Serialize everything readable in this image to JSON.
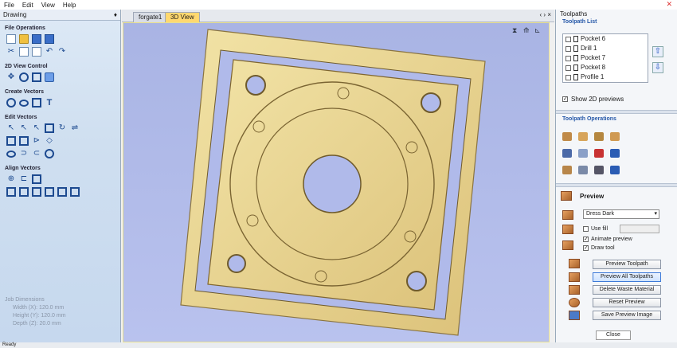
{
  "menu": [
    "File",
    "Edit",
    "View",
    "Help"
  ],
  "left_panel": {
    "title": "Drawing",
    "pin": "♦",
    "sections": {
      "file_ops": "File Operations",
      "view_ctrl": "2D View Control",
      "create_vectors": "Create Vectors",
      "edit_vectors": "Edit Vectors",
      "align_vectors": "Align Vectors"
    },
    "job": {
      "title": "Job Dimensions",
      "width": "Width  (X): 120.0 mm",
      "height": "Height (Y): 120.0 mm",
      "depth": "Depth  (Z): 20.0 mm"
    }
  },
  "tabs": [
    {
      "label": "forgate1",
      "active": false
    },
    {
      "label": "3D View",
      "active": true
    }
  ],
  "tab_controls": "‹ › ×",
  "right_panel": {
    "title": "Toolpaths",
    "pin": "♦",
    "list_title": "Toolpath List",
    "toolpaths": [
      {
        "name": "Pocket 6",
        "checked": false
      },
      {
        "name": "Drill 1",
        "checked": false
      },
      {
        "name": "Pocket 7",
        "checked": false
      },
      {
        "name": "Pocket 8",
        "checked": false
      },
      {
        "name": "Profile 1",
        "checked": false
      }
    ],
    "show_2d": "Show 2D previews",
    "ops_title": "Toolpath Operations",
    "preview_title": "Preview",
    "material": "Dress Dark",
    "use_fill": "Use fill",
    "animate": "Animate preview",
    "draw_tool": "Draw tool",
    "buttons": {
      "preview_toolpath": "Preview Toolpath",
      "preview_all": "Preview All Toolpaths",
      "delete_waste": "Delete Waste Material",
      "reset": "Reset Preview",
      "save_image": "Save Preview Image",
      "close": "Close"
    }
  },
  "status": "Ready",
  "colors": {
    "viewport_bg": "#b0baea",
    "part": "#e8d290",
    "accent_tab": "#ffd870"
  }
}
